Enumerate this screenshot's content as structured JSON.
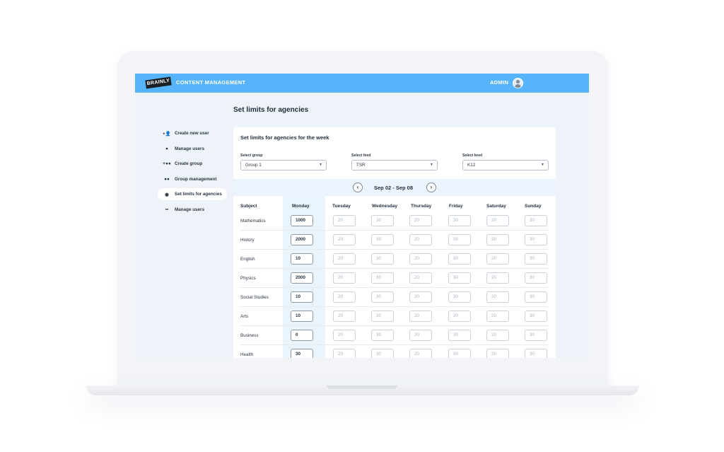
{
  "header": {
    "logo_text": "BRAINLY",
    "app_title": "CONTENT MANAGEMENT",
    "user_label": "ADMIN"
  },
  "sidebar": {
    "items": [
      {
        "label": "Create new user",
        "icon": "add-user-icon"
      },
      {
        "label": "Manage users",
        "icon": "user-icon"
      },
      {
        "label": "Create group",
        "icon": "add-group-icon"
      },
      {
        "label": "Group management",
        "icon": "group-icon"
      },
      {
        "label": "Set limits for agencies",
        "icon": "limit-icon",
        "active": true
      },
      {
        "label": "Manage users",
        "icon": "grid-icon"
      }
    ]
  },
  "main": {
    "page_title": "Set limits for agencies",
    "card_title": "Set limits for agencies for the week",
    "filters": [
      {
        "label": "Select group",
        "value": "Group 1"
      },
      {
        "label": "Select feed",
        "value": "TSR"
      },
      {
        "label": "Select level",
        "value": "K12"
      }
    ],
    "week_label": "Sep 02 - Sep 08",
    "columns": [
      "Subject",
      "Monday",
      "Tuesday",
      "Wednesday",
      "Thursday",
      "Friday",
      "Saturday",
      "Sunday"
    ],
    "rows": [
      {
        "subject": "Mathematics",
        "values": [
          "1000",
          "20",
          "30",
          "20",
          "30",
          "20",
          "30"
        ]
      },
      {
        "subject": "History",
        "values": [
          "2000",
          "20",
          "30",
          "20",
          "30",
          "20",
          "30"
        ]
      },
      {
        "subject": "English",
        "values": [
          "10",
          "20",
          "30",
          "20",
          "30",
          "20",
          "30"
        ]
      },
      {
        "subject": "Physics",
        "values": [
          "2000",
          "20",
          "30",
          "20",
          "30",
          "20",
          "30"
        ]
      },
      {
        "subject": "Social Studies",
        "values": [
          "10",
          "20",
          "30",
          "20",
          "30",
          "20",
          "30"
        ]
      },
      {
        "subject": "Arts",
        "values": [
          "10",
          "20",
          "30",
          "20",
          "30",
          "20",
          "30"
        ]
      },
      {
        "subject": "Business",
        "values": [
          "0",
          "20",
          "30",
          "20",
          "30",
          "20",
          "30"
        ]
      },
      {
        "subject": "Health",
        "values": [
          "30",
          "20",
          "30",
          "20",
          "30",
          "20",
          "30"
        ]
      }
    ]
  },
  "colors": {
    "topbar": "#57b4fb",
    "screen_bg": "#eef3f9",
    "highlight_col": "#eaf4fd"
  }
}
